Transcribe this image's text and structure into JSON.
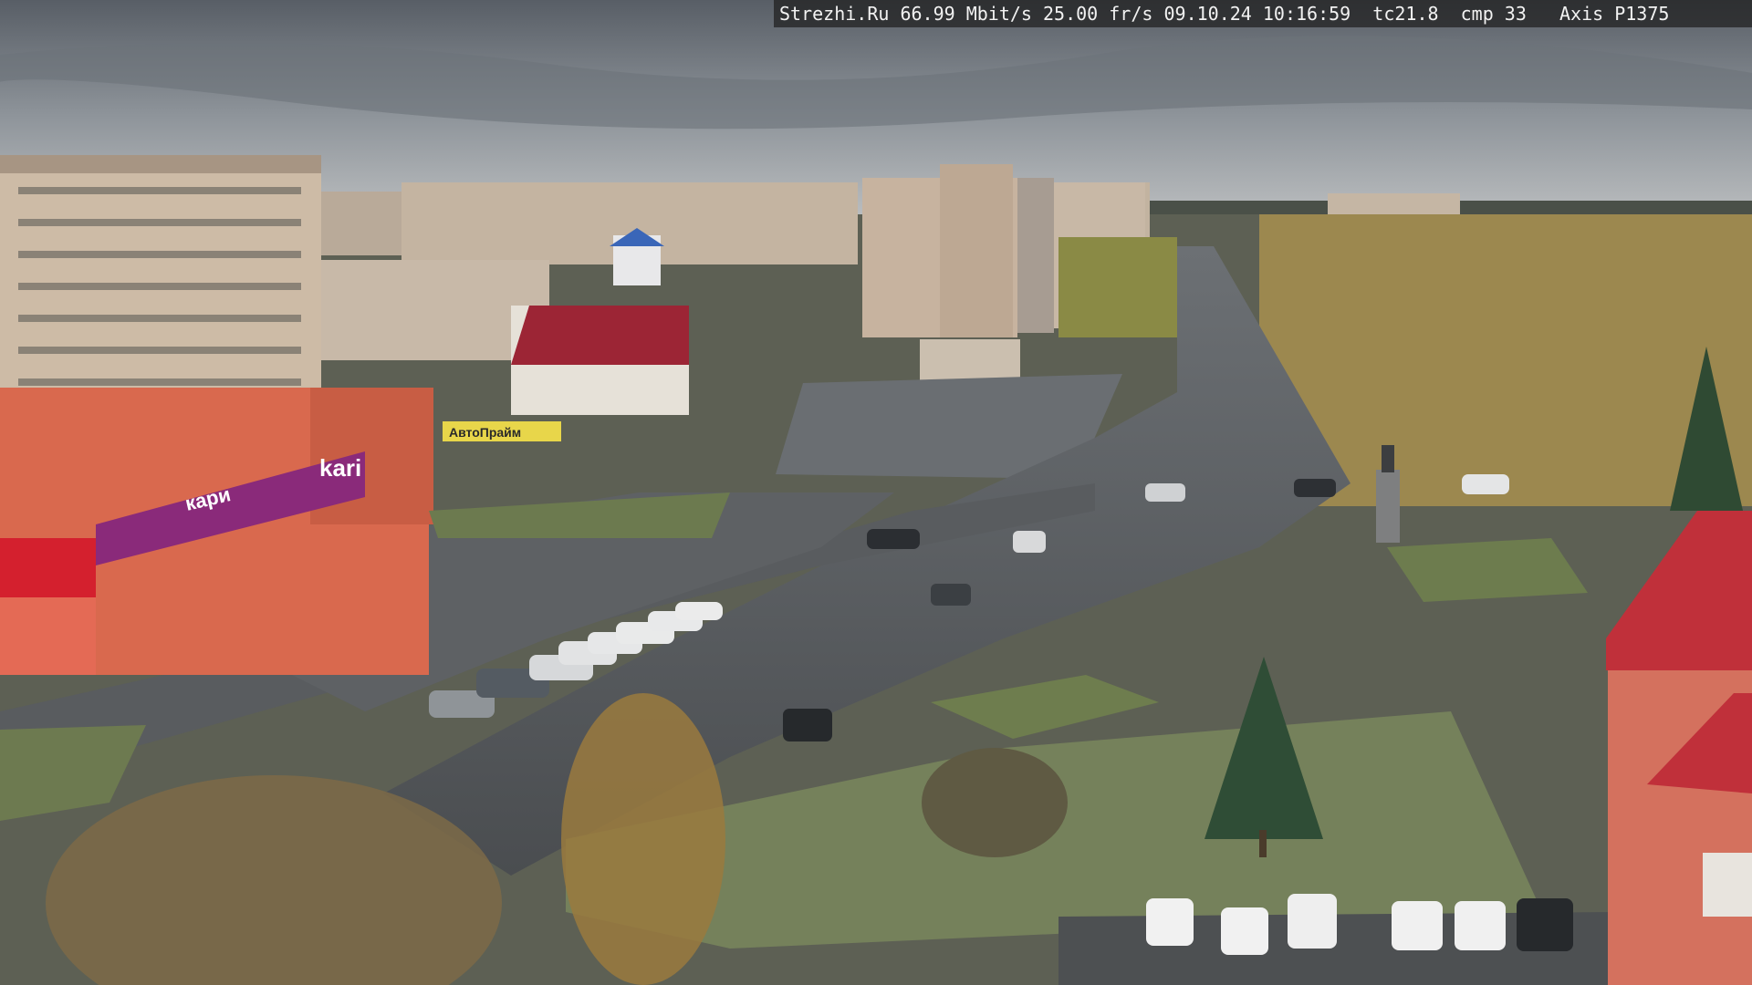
{
  "osd": {
    "site": "Strezhi.Ru",
    "bitrate": "66.99 Mbit/s",
    "framerate": "25.00 fr/s",
    "date": "09.10.24",
    "time": "10:16:59",
    "tc": "tc21.8",
    "cmp": "cmp 33",
    "camera": "Axis P1375"
  },
  "signs": {
    "store_logo": "kari",
    "store_tagline": "кари",
    "shop_sign": "АвтоПрайм"
  },
  "colors": {
    "sky": "#8a9096",
    "road": "#55585a",
    "grass": "#6c7a4f",
    "facade_orange": "#d9694e",
    "kari_purple": "#8a2a7a",
    "roof_red": "#b0273a",
    "tower_roof_red": "#c0303a"
  }
}
